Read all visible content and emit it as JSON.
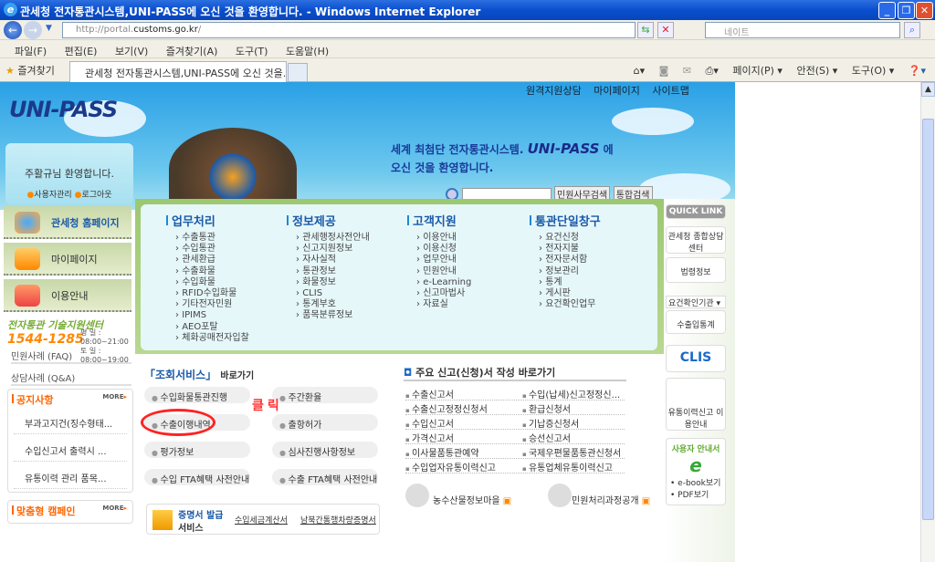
{
  "browser": {
    "window_title": "관세청 전자통관시스템,UNI-PASS에 오신 것을 환영합니다. - Windows Internet Explorer",
    "url_prefix": "http://portal.",
    "url_domain": "customs.go.kr",
    "url_suffix": "/",
    "search_placeholder": "네이트",
    "menu": [
      "파일(F)",
      "편집(E)",
      "보기(V)",
      "즐겨찾기(A)",
      "도구(T)",
      "도움말(H)"
    ],
    "favorites_label": "즐겨찾기",
    "tab_title": "관세청 전자통관시스템,UNI-PASS에 오신 것을...",
    "commands": {
      "page": "페이지(P) ▾",
      "safety": "안전(S) ▾",
      "tools": "도구(O) ▾"
    }
  },
  "header": {
    "logo": "UNI-PASS",
    "top_links": [
      "원격지원상담",
      "마이페이지",
      "사이트맵"
    ],
    "welcome_line1": "세계 최첨단 전자통관시스템.",
    "welcome_brand": "UNI-PASS",
    "welcome_line1_end": "에",
    "welcome_line2": "오신 것을 환영합니다.",
    "search_buttons": [
      "민원사무검색",
      "통합검색"
    ]
  },
  "sidebar": {
    "greeting": "주활규님 환영합니다.",
    "user_links": [
      "사용자관리",
      "로그아웃"
    ],
    "nav": [
      {
        "label": "관세청 홈페이지"
      },
      {
        "label": "마이페이지"
      },
      {
        "label": "이용안내"
      }
    ],
    "support_title": "전자통관 기술지원센터",
    "support_phone": "1544-1285",
    "hours_weekday": "평 일 : 08:00~21:00",
    "hours_saturday": "토 일 : 08:00~19:00",
    "faq": "민원사례 (FAQ)",
    "qna": "상담사례 (Q&A)",
    "notice_title": "공지사항",
    "more": "MORE",
    "notices": [
      "부과고지건(징수형태...",
      "수입신고서 출력시 ...",
      "유통이력 관리 품목..."
    ],
    "campaign_title": "맞춤형 캠페인"
  },
  "menu": [
    {
      "title": "업무처리",
      "items": [
        "수출통관",
        "수입통관",
        "관세환급",
        "수출화물",
        "수입화물",
        "RFID수입화물",
        "기타전자민원",
        "IPIMS",
        "AEO포탈",
        "체화공매전자입찰"
      ]
    },
    {
      "title": "정보제공",
      "items": [
        "관세행정사전안내",
        "신고지원정보",
        "자사실적",
        "통관정보",
        "화물정보",
        "CLIS",
        "통계부호",
        "품목분류정보"
      ]
    },
    {
      "title": "고객지원",
      "items": [
        "이용안내",
        "이용신청",
        "업무안내",
        "민원안내",
        "e-Learning",
        "신고마법사",
        "자료실"
      ]
    },
    {
      "title": "통관단일창구",
      "items": [
        "요건신청",
        "전자지불",
        "전자문서함",
        "정보관리",
        "통계",
        "게시판",
        "요건확인업무"
      ]
    }
  ],
  "lookup": {
    "title_bracket": "「조회서비스」",
    "title_suffix": "바로가기",
    "items": [
      "수입화물통관진행",
      "주간환율",
      "수출이행내역",
      "출항허가",
      "평가정보",
      "심사진행사항정보",
      "수입 FTA혜택 사전안내",
      "수출 FTA혜택 사전안내"
    ],
    "annotation": "클릭",
    "cert_title": "증명서 발급",
    "cert_sub": "서비스",
    "cert_links": [
      "수입세금계산서",
      "남북간통행차량증명서"
    ]
  },
  "forms": {
    "title": "주요 신고(신청)서 작성 바로가기",
    "items": [
      "수출신고서",
      "수입(납세)신고정정신...",
      "수출신고정정신청서",
      "환급신청서",
      "수입신고서",
      "기납증신청서",
      "가격신고서",
      "승선신고서",
      "이사물품통관예약",
      "국제우편물품통관신청서",
      "수입업자유통이력신고",
      "유통업체유통이력신고"
    ],
    "links": [
      "농수산물정보마을",
      "민원처리과정공개"
    ]
  },
  "quick": {
    "title": "QUICK LINK",
    "items": [
      "관세청 종합상담센터",
      "법령정보"
    ],
    "select": "요건확인기관",
    "stats": "수출입통계",
    "clis": "CLIS",
    "distribution": "유통이력신고 이용안내",
    "guide_title": "사용자 안내서",
    "guide_links": [
      "• e-book보기",
      "• PDF보기"
    ]
  },
  "colors": {
    "accent": "#1a5aa8",
    "notice": "#ff6600",
    "annotation": "#ff2222"
  }
}
